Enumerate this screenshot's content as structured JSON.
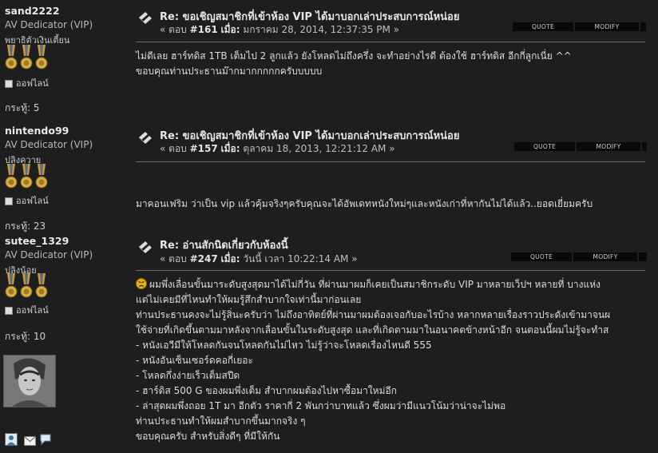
{
  "posts": [
    {
      "author": {
        "name": "sand2222",
        "rank": "AV Dedicator (VIP)",
        "title": "พยาธิตัวเงินเตี้ยน",
        "status": "ออฟไลน์",
        "post_count": "กระทู้: 5"
      },
      "title": "Re: ขอเชิญสมาชิกที่เข้าห้อง VIP ได้มาบอกเล่าประสบการณ์หน่อย",
      "reply_prefix": "« ตอบ",
      "reply_no": "#161",
      "on_label": "เมื่อ:",
      "date": "มกราคม 28, 2014, 12:37:35 PM »",
      "buttons": {
        "quote": "QUOTE",
        "modify": "MODIFY"
      },
      "body": [
        "ไม่ดีเลย ฮาร์ทดิส 1TB เต็มไป 2 ลูกแล้ว ยังโหลดไม่ถึงครึ่ง   จะทำอย่างไรดี ต้องใช้ ฮาร์ทดิส อีกกี่ลูกเนี่ย ^^",
        "ขอบคุณท่านประธานม๊ากมากกกกกครับบบบบ"
      ]
    },
    {
      "author": {
        "name": "nintendo99",
        "rank": "AV Dedicator (VIP)",
        "title": "ปลิงควาย",
        "status": "ออฟไลน์",
        "post_count": "กระทู้: 23"
      },
      "title": "Re: ขอเชิญสมาชิกที่เข้าห้อง VIP ได้มาบอกเล่าประสบการณ์หน่อย",
      "reply_prefix": "« ตอบ",
      "reply_no": "#157",
      "on_label": "เมื่อ:",
      "date": "ตุลาคม 18, 2013, 12:21:12 AM »",
      "buttons": {
        "quote": "QUOTE",
        "modify": "MODIFY"
      },
      "body": [
        "มาคอนเฟริม ว่าเป็น vip แล้วคุ้มจริงๆครับคุณจะได้อัพเดทหนังใหม่ๆและหนังเก่าที่หากันไม่ได้แล้ว..ยอดเยี่ยมครับ"
      ]
    },
    {
      "author": {
        "name": "sutee_1329",
        "rank": "AV Dedicator (VIP)",
        "title": "ปลิงน้อย",
        "status": "ออฟไลน์",
        "post_count": "กระทู้: 10"
      },
      "title": "Re: อ่านสักนิดเกี่ยวกับห้องนี้",
      "reply_prefix": "« ตอบ",
      "reply_no": "#247",
      "on_label": "เมื่อ:",
      "date": "วันนี้ เวลา 10:22:14 AM »",
      "buttons": {
        "quote": "QUOTE",
        "modify": "MODIFY"
      },
      "body": [
        "ผมพึ่งเลื่อนขั้นมาระดับสูงสุดมาได้ไม่กี่วัน ที่ผ่านมาผมก็เคยเป็นสมาชิกระดับ VIP มาหลายเว็ปฯ หลายที่ บางแห่ง",
        "แต่ไม่เคยมีที่ไหนทำให้ผมรู้สึกสำบากใจเท่านี้มาก่อนเลย",
        "ท่านประธานคงจะไม่รู้สิ่นะครับว่า ไม่ถึงอาทิตย์ที่ผ่านมาผมต้องเจอกับอะไรบ้าง หลากหลายเรื่องราวประดังเข้ามาจนผ",
        "ใช้จ่ายที่เกิดขึ้นตามมาหลังจากเลื่อนขั้นในระดับสูงสุด และที่เกิดตามมาในอนาคตข้างหน้าอีก จนตอนนี้ผมไม่รู้จะทำส",
        "- หนังเอวีมีให้โหลดกันจนโหลดกันไม่ไหว ไม่รู้ว่าจะโหลดเรื่องไหนดี 555",
        "- หนังอันเซ็นเซอร์ดคอกี่เยอะ",
        "- โหลดกึ่งง่ายเร็วเต็มสปีด",
        "- ฮาร์ดิส 500 G ของผมพึ่งเต็ม สำบากผมต้องไปหาซื้อมาใหม่อีก",
        "- ล่าสุดผมพึ่งถอย 1T มา อีกตัว ราคากี่ 2 พันกว่าบาทแล้ว ซึ่งผมว่ามีแนวโน้มว่าน่าจะไม่พอ",
        "ท่านประธานทำให้ผมสำบากขึ้นมากจริง ๆ",
        "ขอบคุณครับ สำหรับสิ่งดีๆ ที่มีให้กัน"
      ],
      "smiley": "angry-smiley-icon"
    }
  ]
}
